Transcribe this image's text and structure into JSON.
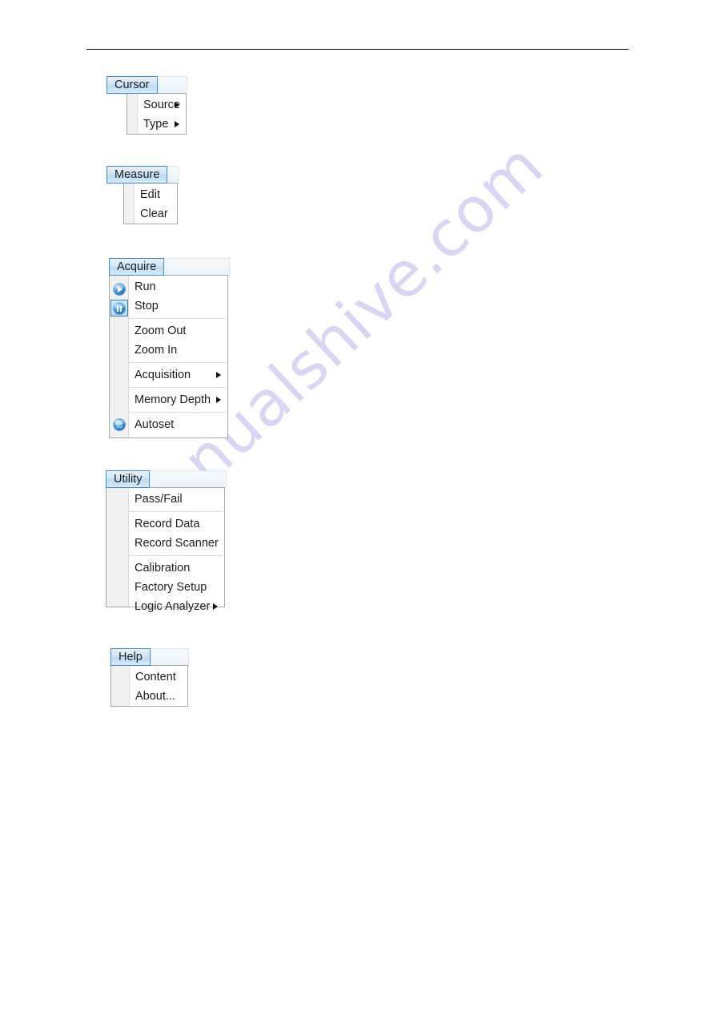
{
  "page": {
    "watermark_text": "manualshive.com",
    "watermark_color": "#c9c9ef",
    "accent_color": "#3f8bcf",
    "menu_border_color": "#a8a8a8",
    "gutter_color": "#f1f1f1"
  },
  "menus": [
    {
      "id": "cursor",
      "tab_label": "Cursor",
      "items": [
        {
          "label": "Source",
          "submenu": true,
          "icon": null,
          "separator_before": false
        },
        {
          "label": "Type",
          "submenu": true,
          "icon": null,
          "separator_before": false
        }
      ]
    },
    {
      "id": "measure",
      "tab_label": "Measure",
      "items": [
        {
          "label": "Edit",
          "submenu": false,
          "icon": null,
          "separator_before": false
        },
        {
          "label": "Clear",
          "submenu": false,
          "icon": null,
          "separator_before": false
        }
      ]
    },
    {
      "id": "acquire",
      "tab_label": "Acquire",
      "items": [
        {
          "label": "Run",
          "submenu": false,
          "icon": "run-play-icon",
          "separator_before": false
        },
        {
          "label": "Stop",
          "submenu": false,
          "icon": "stop-pause-icon",
          "separator_before": false
        },
        {
          "label": "Zoom Out",
          "submenu": false,
          "icon": null,
          "separator_before": true
        },
        {
          "label": "Zoom In",
          "submenu": false,
          "icon": null,
          "separator_before": false
        },
        {
          "label": "Acquisition",
          "submenu": true,
          "icon": null,
          "separator_before": true
        },
        {
          "label": "Memory Depth",
          "submenu": true,
          "icon": null,
          "separator_before": true
        },
        {
          "label": "Autoset",
          "submenu": false,
          "icon": "autoset-icon",
          "separator_before": true
        }
      ]
    },
    {
      "id": "utility",
      "tab_label": "Utility",
      "items": [
        {
          "label": "Pass/Fail",
          "submenu": false,
          "icon": null,
          "separator_before": false
        },
        {
          "label": "Record Data",
          "submenu": false,
          "icon": null,
          "separator_before": true
        },
        {
          "label": "Record Scanner",
          "submenu": false,
          "icon": null,
          "separator_before": false
        },
        {
          "label": "Calibration",
          "submenu": false,
          "icon": null,
          "separator_before": true
        },
        {
          "label": "Factory Setup",
          "submenu": false,
          "icon": null,
          "separator_before": false
        },
        {
          "label": "Logic Analyzer",
          "submenu": true,
          "icon": null,
          "separator_before": false
        }
      ]
    },
    {
      "id": "help",
      "tab_label": "Help",
      "items": [
        {
          "label": "Content",
          "submenu": false,
          "icon": null,
          "separator_before": false
        },
        {
          "label": "About...",
          "submenu": false,
          "icon": null,
          "separator_before": false
        }
      ]
    }
  ]
}
